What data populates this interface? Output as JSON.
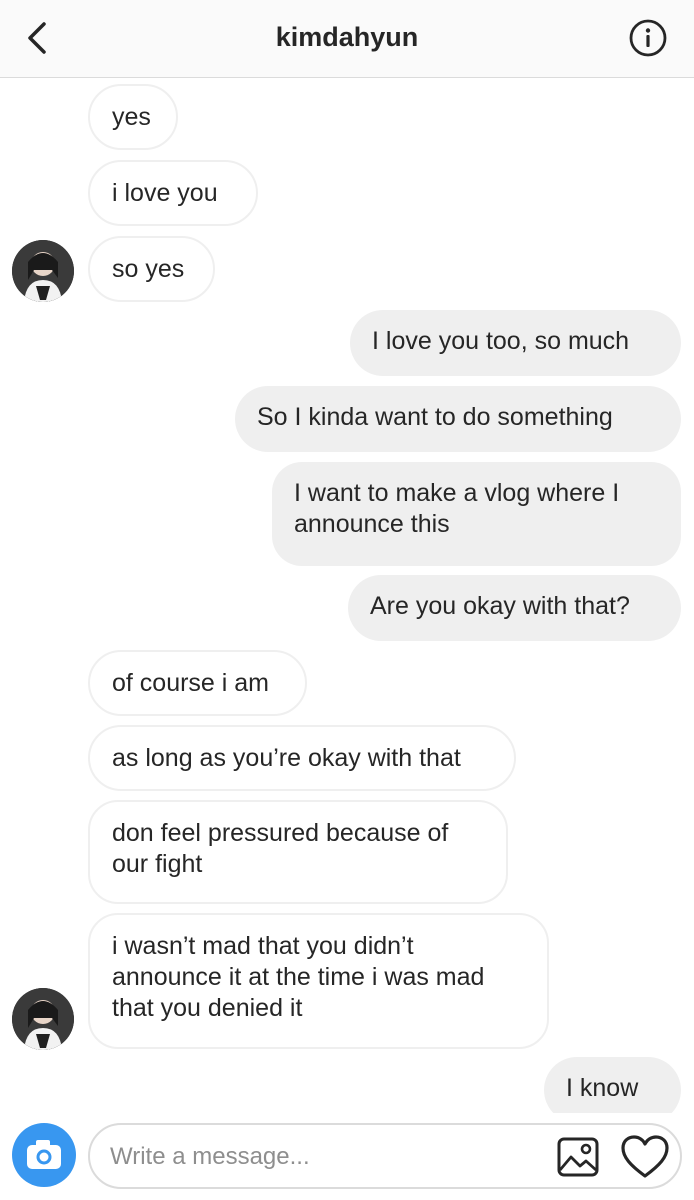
{
  "header": {
    "title": "kimdahyun",
    "back_icon": "chevron-left-icon",
    "info_icon": "info-circle-icon"
  },
  "messages": [
    {
      "side": "recv",
      "text": "yes"
    },
    {
      "side": "recv",
      "text": "i love you"
    },
    {
      "side": "recv",
      "text": "so yes"
    },
    {
      "side": "sent",
      "text": "I love you too, so much"
    },
    {
      "side": "sent",
      "text": "So I kinda want to do something"
    },
    {
      "side": "sent",
      "text": "I want to make a vlog where I announce this"
    },
    {
      "side": "sent",
      "text": "Are you okay with that?"
    },
    {
      "side": "recv",
      "text": "of course i am"
    },
    {
      "side": "recv",
      "text": "as long as you’re okay with that"
    },
    {
      "side": "recv",
      "text": "don feel pressured because of our fight"
    },
    {
      "side": "recv",
      "text": "i wasn’t mad that you didn’t announce it at the time i was mad that you denied it"
    },
    {
      "side": "sent",
      "text": "I know"
    }
  ],
  "composer": {
    "placeholder": "Write a message...",
    "camera_icon": "camera-icon",
    "gallery_icon": "image-icon",
    "like_icon": "heart-icon"
  },
  "colors": {
    "camera_accent": "#3897f0",
    "sent_bubble": "#efefef",
    "received_border": "#efefef"
  }
}
